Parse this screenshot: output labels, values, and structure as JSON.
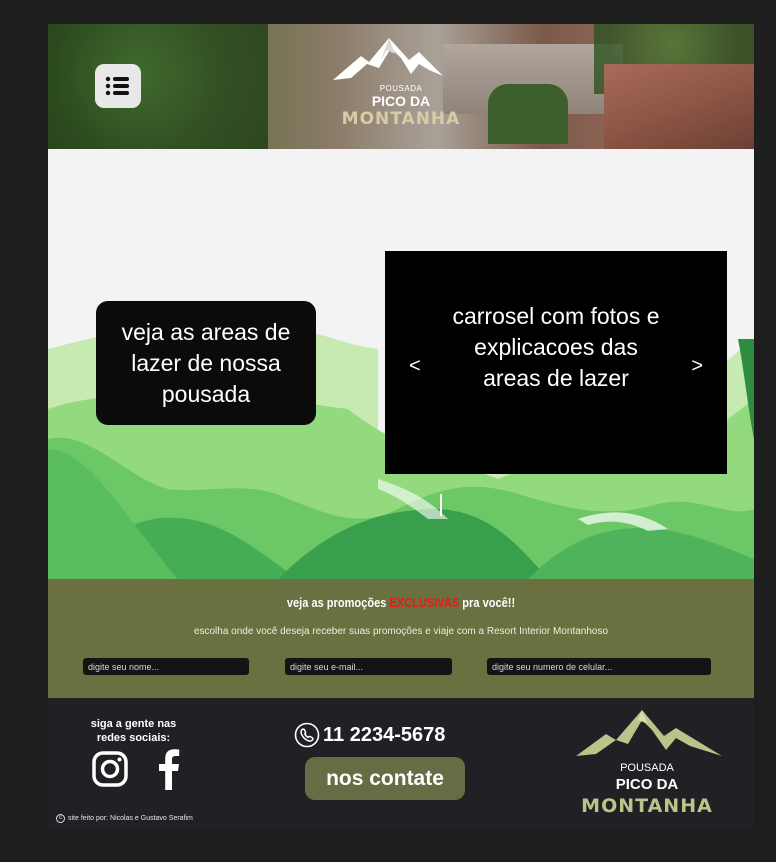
{
  "header": {
    "logo": {
      "pousada": "POUSADA",
      "line1": "PICO DA",
      "line2": "MONTANHA"
    },
    "menu_icon": "hamburger-list-icon"
  },
  "hero": {
    "info_text": "veja as areas de lazer de nossa pousada",
    "carousel": {
      "text": "carrosel com fotos e explicacoes das areas de lazer",
      "prev": "<",
      "next": ">"
    }
  },
  "promo": {
    "title_before": "veja as promoções ",
    "title_highlight": "EXCLUSIVAS",
    "title_after": " pra você!!",
    "subtitle": "escolha onde você deseja receber suas promoções e viaje com a Resort Interior Montanhoso",
    "name_placeholder": "digite seu nome...",
    "email_placeholder": "digite seu e-mail...",
    "phone_placeholder": "digite seu numero de celular...",
    "colors": {
      "band": "#6a7040",
      "highlight": "#e81a1a"
    }
  },
  "footer": {
    "social_title": "siga a gente nas redes sociais:",
    "phone": "11 2234-5678",
    "contact_button": "nos contate",
    "credit": "site feito por: Nicolas e Gustavo Serafim",
    "logo": {
      "pousada": "POUSADA",
      "line1": "PICO DA",
      "line2": "MONTANHA"
    },
    "icons": [
      "instagram-icon",
      "facebook-icon",
      "phone-icon"
    ]
  }
}
